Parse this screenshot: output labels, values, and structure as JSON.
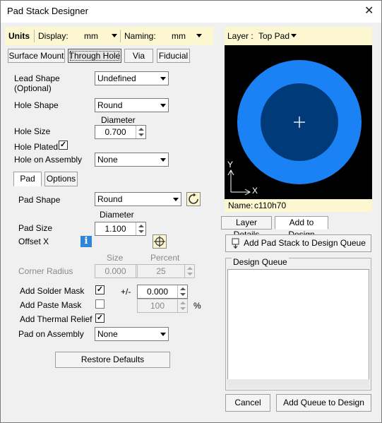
{
  "window": {
    "title": "Pad Stack Designer",
    "close_glyph": "✕"
  },
  "units_bar": {
    "units_label": "Units",
    "display_label": "Display:",
    "display_value": "mm",
    "naming_label": "Naming:",
    "naming_value": "mm"
  },
  "type_tabs": [
    "Surface Mount",
    "Through Hole",
    "Via",
    "Fiducial"
  ],
  "hole": {
    "lead_shape_label": "Lead Shape",
    "lead_shape_sublabel": "(Optional)",
    "lead_shape_value": "Undefined",
    "hole_shape_label": "Hole Shape",
    "hole_shape_value": "Round",
    "diameter_header": "Diameter",
    "hole_size_label": "Hole Size",
    "hole_size_value": "0.700",
    "hole_plated_label": "Hole Plated",
    "hole_plated_checked": "✓",
    "hole_on_assembly_label": "Hole on Assembly",
    "hole_on_assembly_value": "None"
  },
  "pad_tabs": [
    "Pad",
    "Options"
  ],
  "pad": {
    "pad_shape_label": "Pad Shape",
    "pad_shape_value": "Round",
    "diameter_header": "Diameter",
    "pad_size_label": "Pad Size",
    "pad_size_value": "1.100",
    "offset_x_label": "Offset X",
    "size_header": "Size",
    "percent_header": "Percent",
    "corner_radius_label": "Corner Radius",
    "corner_size_value": "0.000",
    "corner_percent_value": "25",
    "solder_mask_label": "Add Solder Mask",
    "solder_mask_checked": "✓",
    "plus_minus": "+/-",
    "solder_mask_value": "0.000",
    "paste_mask_label": "Add Paste Mask",
    "paste_mask_value": "100",
    "percent_sign": "%",
    "thermal_relief_label": "Add Thermal Relief",
    "thermal_relief_checked": "✓",
    "pad_on_assembly_label": "Pad on Assembly",
    "pad_on_assembly_value": "None",
    "restore_defaults": "Restore Defaults"
  },
  "preview": {
    "layer_label": "Layer :",
    "layer_value": "Top Pad",
    "axis_y": "Y",
    "axis_x": "X",
    "name_label": "Name:",
    "name_value": "c110h70",
    "colors": {
      "outer": "#1a82f5",
      "inner": "#003a78",
      "background": "#000000"
    }
  },
  "right_tabs": [
    "Layer Details",
    "Add to Design"
  ],
  "add_stack_button": "Add Pad Stack to Design Queue",
  "queue": {
    "title": "Design Queue",
    "items": []
  },
  "footer": {
    "cancel": "Cancel",
    "add_queue": "Add Queue to Design"
  }
}
